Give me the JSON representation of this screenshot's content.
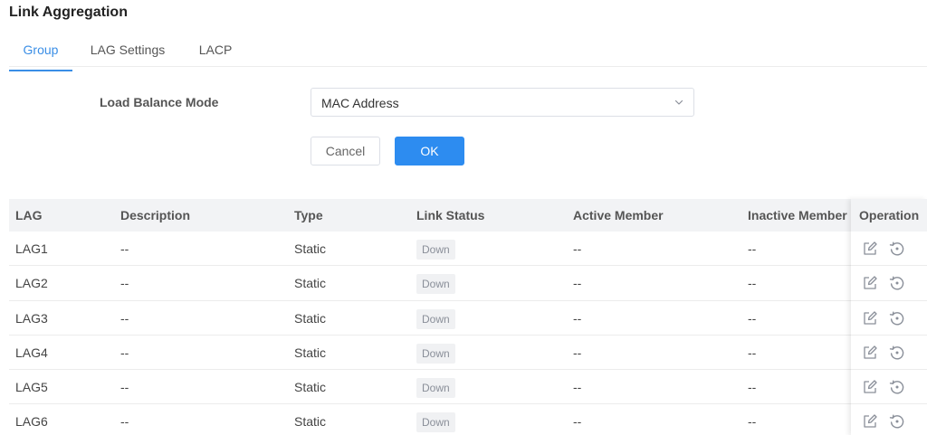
{
  "page_title": "Link Aggregation",
  "tabs": [
    {
      "label": "Group",
      "active": true
    },
    {
      "label": "LAG Settings",
      "active": false
    },
    {
      "label": "LACP",
      "active": false
    }
  ],
  "form": {
    "load_balance_label": "Load Balance Mode",
    "load_balance_value": "MAC Address",
    "cancel_label": "Cancel",
    "ok_label": "OK"
  },
  "table": {
    "headers": [
      "LAG",
      "Description",
      "Type",
      "Link Status",
      "Active Member",
      "Inactive Member",
      "Operation"
    ],
    "rows": [
      {
        "lag": "LAG1",
        "description": "--",
        "type": "Static",
        "status": "Down",
        "active": "--",
        "inactive": "--"
      },
      {
        "lag": "LAG2",
        "description": "--",
        "type": "Static",
        "status": "Down",
        "active": "--",
        "inactive": "--"
      },
      {
        "lag": "LAG3",
        "description": "--",
        "type": "Static",
        "status": "Down",
        "active": "--",
        "inactive": "--"
      },
      {
        "lag": "LAG4",
        "description": "--",
        "type": "Static",
        "status": "Down",
        "active": "--",
        "inactive": "--"
      },
      {
        "lag": "LAG5",
        "description": "--",
        "type": "Static",
        "status": "Down",
        "active": "--",
        "inactive": "--"
      },
      {
        "lag": "LAG6",
        "description": "--",
        "type": "Static",
        "status": "Down",
        "active": "--",
        "inactive": "--"
      }
    ]
  },
  "colors": {
    "accent": "#2d8cf0",
    "tab_active": "#3a8ee6",
    "header_bg": "#f2f3f5",
    "badge_bg": "#f0f1f3"
  },
  "icons": {
    "select_arrow": "chevron-down-icon",
    "edit": "edit-icon",
    "reset": "reset-icon"
  }
}
